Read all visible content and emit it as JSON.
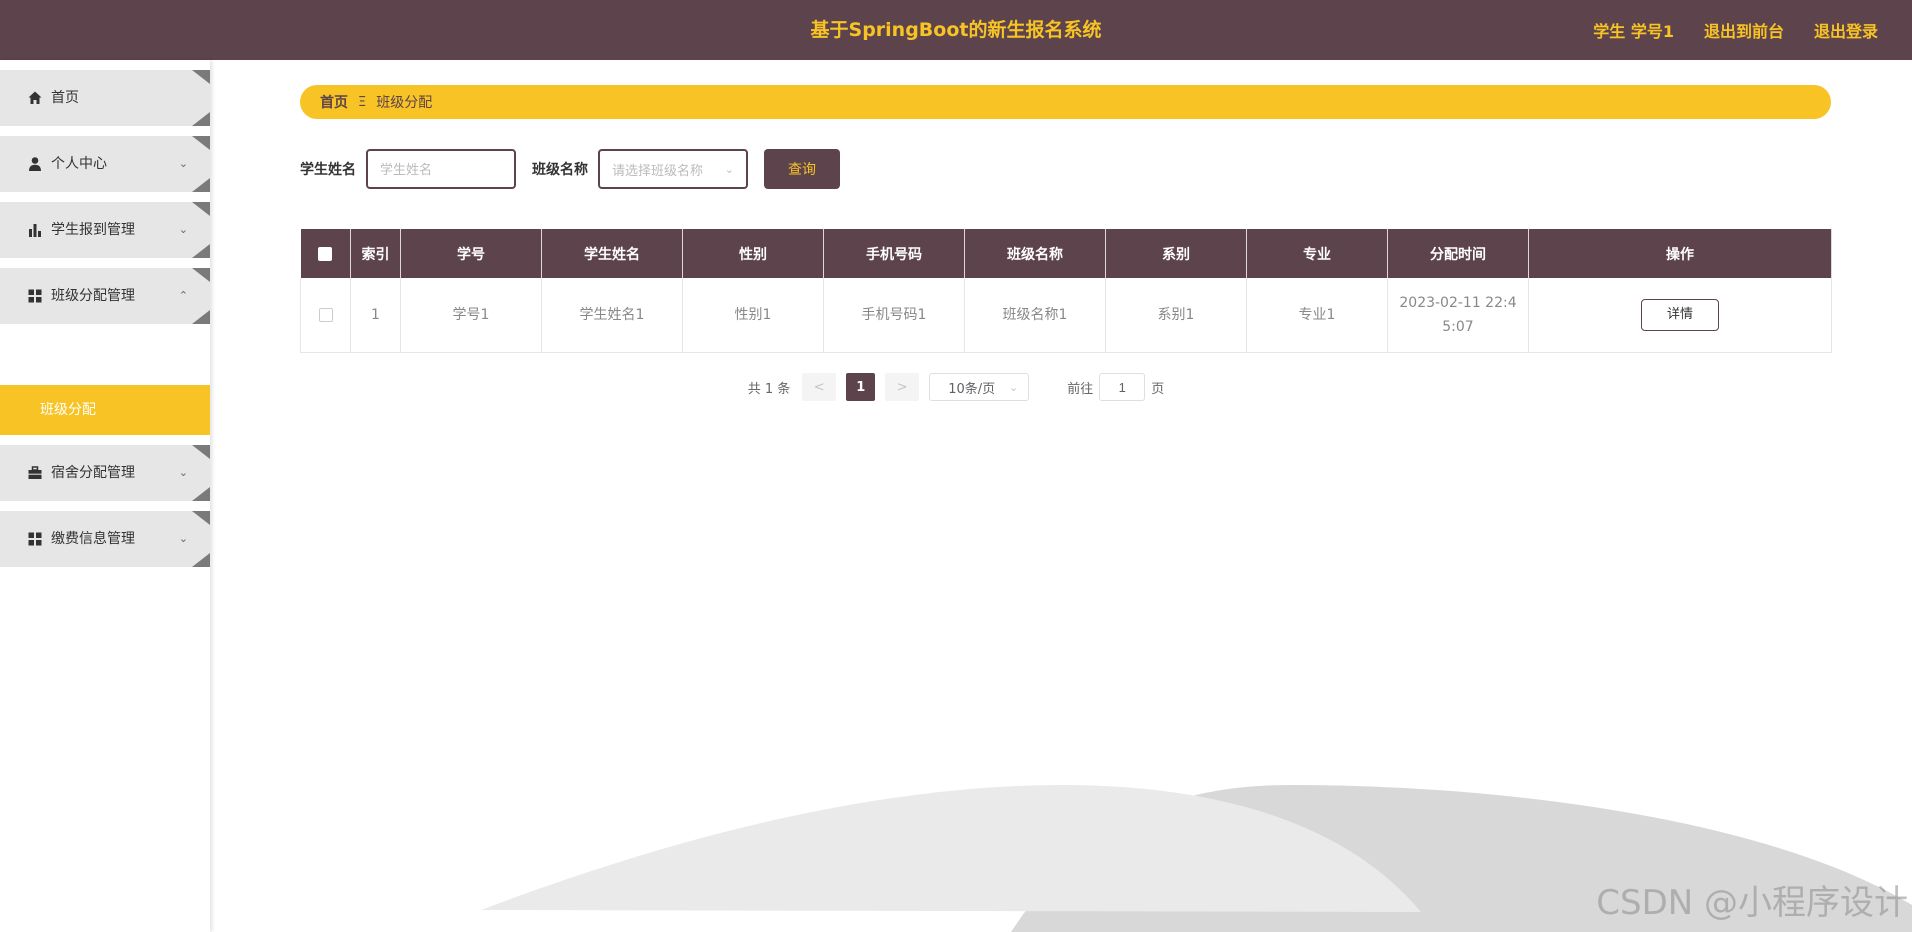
{
  "header": {
    "title": "基于SpringBoot的新生报名系统",
    "user": "学生 学号1",
    "back_to_front": "退出到前台",
    "logout": "退出登录"
  },
  "sidebar": {
    "items": [
      {
        "label": "首页",
        "icon": "home-icon"
      },
      {
        "label": "个人中心",
        "icon": "user-icon"
      },
      {
        "label": "学生报到管理",
        "icon": "bar-chart-icon"
      },
      {
        "label": "班级分配管理",
        "icon": "grid-icon"
      },
      {
        "label": "宿舍分配管理",
        "icon": "briefcase-icon"
      },
      {
        "label": "缴费信息管理",
        "icon": "grid-icon"
      }
    ],
    "active_sub": "班级分配"
  },
  "breadcrumb": {
    "home": "首页",
    "separator": "Ξ",
    "current": "班级分配"
  },
  "search": {
    "name_label": "学生姓名",
    "name_placeholder": "学生姓名",
    "class_label": "班级名称",
    "class_placeholder": "请选择班级名称",
    "query_button": "查询"
  },
  "table": {
    "headers": [
      "索引",
      "学号",
      "学生姓名",
      "性别",
      "手机号码",
      "班级名称",
      "系别",
      "专业",
      "分配时间",
      "操作"
    ],
    "rows": [
      {
        "index": "1",
        "student_no": "学号1",
        "name": "学生姓名1",
        "gender": "性别1",
        "phone": "手机号码1",
        "class_name": "班级名称1",
        "department": "系别1",
        "major": "专业1",
        "time_line1": "2023-02-11 22:4",
        "time_line2": "5:07",
        "action": "详情"
      }
    ]
  },
  "pagination": {
    "total": "共 1 条",
    "prev": "<",
    "current_page": "1",
    "next": ">",
    "page_size": "10条/页",
    "goto_label": "前往",
    "goto_value": "1",
    "page_suffix": "页"
  },
  "watermark": "CSDN @小程序设计",
  "colors": {
    "primary": "#5d434b",
    "accent": "#f7c325"
  }
}
